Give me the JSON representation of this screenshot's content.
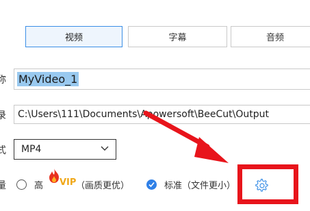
{
  "tabs": [
    {
      "label": "视频",
      "active": true
    },
    {
      "label": "字幕",
      "active": false
    },
    {
      "label": "音频",
      "active": false
    }
  ],
  "form": {
    "name_label_partial": "称",
    "name_value": "MyVideo_1",
    "path_label_partial": "录",
    "path_value": "C:\\Users\\111\\Documents\\Apowersoft\\BeeCut\\Output",
    "format_label_partial": "式",
    "format_value": "MP4",
    "quality_label_partial": "量"
  },
  "quality": {
    "high_label": "高",
    "vip_label": "VIP",
    "high_note": "（画质更优）",
    "standard_label": "标准（文件更小）",
    "selected": "standard"
  },
  "icons": {
    "settings": "gear-icon",
    "vip_badge": "flame-icon",
    "dropdown": "chevron-down-icon"
  },
  "colors": {
    "accent": "#3a8ee6",
    "annotation": "#e8141b",
    "vip": "#f0a81a"
  }
}
